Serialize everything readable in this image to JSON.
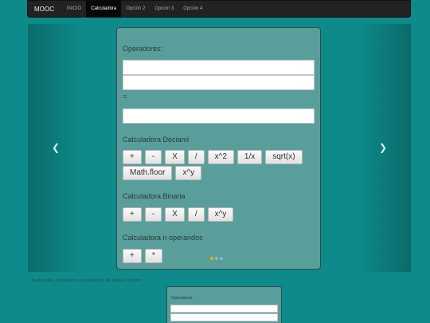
{
  "navbar": {
    "brand": "MOOC",
    "items": [
      {
        "label": "INICIO",
        "active": false
      },
      {
        "label": "Calculadora",
        "active": true
      },
      {
        "label": "Opción 2",
        "active": false
      },
      {
        "label": "Opción 3",
        "active": false
      },
      {
        "label": "Opción 4",
        "active": false
      }
    ]
  },
  "carousel": {
    "prev_icon": "chevron-left-icon",
    "next_icon": "chevron-right-icon",
    "prev_glyph": "❮",
    "next_glyph": "❯",
    "slide_count": 3,
    "active_slide": 1
  },
  "calculator": {
    "operators_label": "Operadores:",
    "operand1_value": "",
    "operand2_value": "",
    "equals_label": "=",
    "result_value": "",
    "decimal": {
      "label": "Calculadora Deciaml",
      "buttons_row1": [
        "+",
        "-",
        "X",
        "/",
        "x^2",
        "1/x",
        "sqrt(x)"
      ],
      "buttons_row2": [
        "Math.floor",
        "x^y"
      ]
    },
    "binary": {
      "label": "Calculadora Binaria",
      "buttons": [
        "+",
        "-",
        "X",
        "/",
        "x^y"
      ]
    },
    "n_operands": {
      "label": "Calculadora n operandos",
      "buttons": [
        "+",
        "*"
      ]
    }
  },
  "footer_text": "Buenas días, bienvenido a la calculadora de Joaquín Centeno",
  "lower_panel": {
    "operators_label": "Operadores:"
  },
  "colors": {
    "background": "#0e8a8a",
    "panel": "#5a9e9b",
    "navbar": "#222222",
    "active_dot": "#f0b400"
  }
}
